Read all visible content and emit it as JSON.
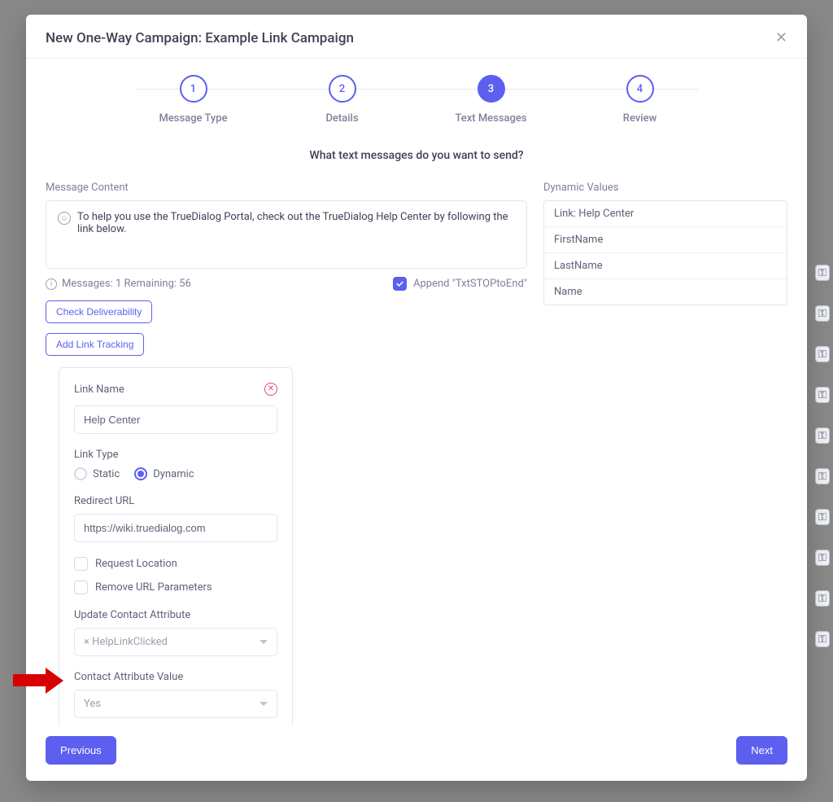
{
  "header": {
    "title": "New One-Way Campaign: Example Link Campaign"
  },
  "stepper": {
    "steps": [
      {
        "num": "1",
        "label": "Message Type"
      },
      {
        "num": "2",
        "label": "Details"
      },
      {
        "num": "3",
        "label": "Text Messages"
      },
      {
        "num": "4",
        "label": "Review"
      }
    ],
    "active_index": 2
  },
  "prompt": "What text messages do you want to send?",
  "message": {
    "label": "Message Content",
    "text": "To help you use the TrueDialog Portal, check out the TrueDialog Help Center by following the link below.",
    "info": "Messages: 1 Remaining: 56",
    "append_label": "Append \"TxtSTOPtoEnd\"",
    "append_checked": true
  },
  "buttons": {
    "check_deliverability": "Check Deliverability",
    "add_link_tracking": "Add Link Tracking",
    "previous": "Previous",
    "next": "Next"
  },
  "dynamic": {
    "label": "Dynamic Values",
    "items": [
      "Link: Help Center",
      "FirstName",
      "LastName",
      "Name"
    ]
  },
  "link_card": {
    "link_name_label": "Link Name",
    "link_name_value": "Help Center",
    "link_type_label": "Link Type",
    "static_label": "Static",
    "dynamic_label": "Dynamic",
    "link_type_selected": "Dynamic",
    "redirect_label": "Redirect URL",
    "redirect_value": "https://wiki.truedialog.com",
    "request_location_label": "Request Location",
    "request_location_checked": false,
    "remove_params_label": "Remove URL Parameters",
    "remove_params_checked": false,
    "update_attr_label": "Update Contact Attribute",
    "update_attr_value": "HelpLinkClicked",
    "attr_value_label": "Contact Attribute Value",
    "attr_value_value": "Yes"
  }
}
